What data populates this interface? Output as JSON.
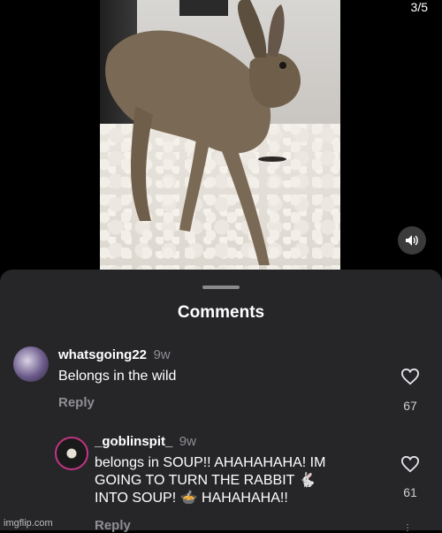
{
  "viewer": {
    "page_counter": "3/5"
  },
  "sheet": {
    "title": "Comments"
  },
  "comments": [
    {
      "username": "whatsgoing22",
      "time": "9w",
      "text": "Belongs in the wild",
      "reply_label": "Reply",
      "likes": "67"
    },
    {
      "username": "_goblinspit_",
      "time": "9w",
      "text_line1": "belongs in SOUP!! AHAHAHAHA! IM",
      "text_line2": "GOING TO TURN THE RABBIT 🐇",
      "text_line3": "INTO SOUP! 🍲 HAHAHAHA!!",
      "reply_label": "Reply",
      "likes": "61"
    }
  ],
  "watermark": "imgflip.com",
  "colors": {
    "sheet_bg": "#262629",
    "muted_text": "#8e8e93",
    "story_ring": "#c13584"
  },
  "icons": {
    "volume": "volume-icon",
    "like": "heart-icon"
  }
}
